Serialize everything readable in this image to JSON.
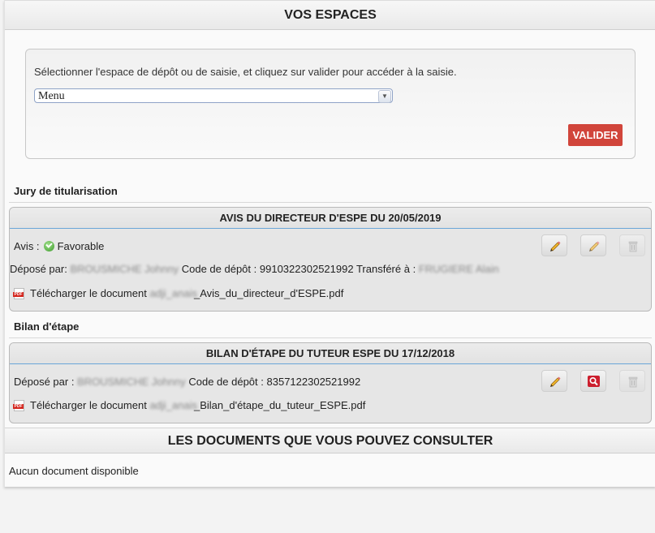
{
  "header": {
    "title": "VOS ESPACES"
  },
  "space_selector": {
    "instruction": "Sélectionner l'espace de dépôt ou de saisie, et cliquez sur valider pour accéder à la saisie.",
    "select_value": "Menu",
    "validate_label": "VALIDER"
  },
  "sections": [
    {
      "title": "Jury de titularisation",
      "card": {
        "title": "AVIS DU DIRECTEUR D'ESPE DU 20/05/2019",
        "avis_label": "Avis :",
        "avis_value": "Favorable",
        "deposited_label": "Déposé par:",
        "deposited_by": "BROUSMICHE Johnny",
        "code_label": "Code de dépôt :",
        "code": "9910322302521992",
        "transferred_label": "Transféré à :",
        "transferred_to": "FRUGIERE Alain",
        "download_label": "Télécharger le document",
        "file_prefix": "adji_anais",
        "file_suffix": "_Avis_du_directeur_d'ESPE.pdf",
        "actions": [
          "edit-icon",
          "edit-icon",
          "trash-icon"
        ]
      }
    },
    {
      "title": "Bilan d'étape",
      "card": {
        "title": "BILAN D'ÉTAPE DU TUTEUR ESPE DU 17/12/2018",
        "deposited_label": "Déposé par :",
        "deposited_by": "BROUSMICHE Johnny",
        "code_label": "Code de dépôt :",
        "code": "8357122302521992",
        "download_label": "Télécharger le document",
        "file_prefix": "adji_anais",
        "file_suffix": "_Bilan_d'étape_du_tuteur_ESPE.pdf",
        "actions": [
          "edit-icon",
          "search-icon",
          "trash-icon"
        ]
      }
    }
  ],
  "consult": {
    "title": "LES DOCUMENTS QUE VOUS POUVEZ CONSULTER",
    "empty_text": "Aucun document disponible"
  },
  "colors": {
    "validate": "#d1453b",
    "card_rule": "#6aa6d8",
    "view_button": "#cc1f2e"
  }
}
